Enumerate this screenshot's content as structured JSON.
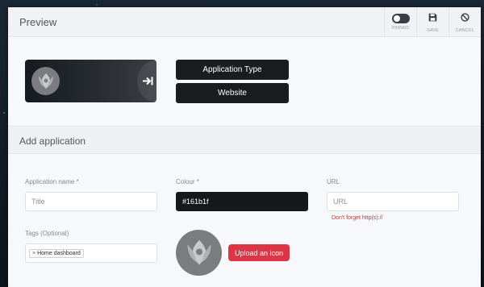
{
  "header": {
    "title": "Preview",
    "buttons": [
      {
        "label": "PINNED",
        "icon": "toggle-icon"
      },
      {
        "label": "SAVE",
        "icon": "save-icon"
      },
      {
        "label": "CANCEL",
        "icon": "cancel-icon"
      }
    ]
  },
  "preview": {
    "buttons": [
      "Application Type",
      "Website"
    ]
  },
  "section": {
    "title": "Add application"
  },
  "form": {
    "name": {
      "label": "Application name *",
      "placeholder": "Title"
    },
    "colour": {
      "label": "Colour *",
      "value": "#161b1f"
    },
    "url": {
      "label": "URL",
      "placeholder": "URL",
      "hint": "Don't forget http(s)://"
    },
    "tags": {
      "label": "Tags (Optional)",
      "items": [
        "Home dashboard"
      ]
    },
    "upload": {
      "label": "Upload an icon"
    }
  },
  "colors": {
    "accent": "#dc3545",
    "dark": "#161b1f"
  }
}
